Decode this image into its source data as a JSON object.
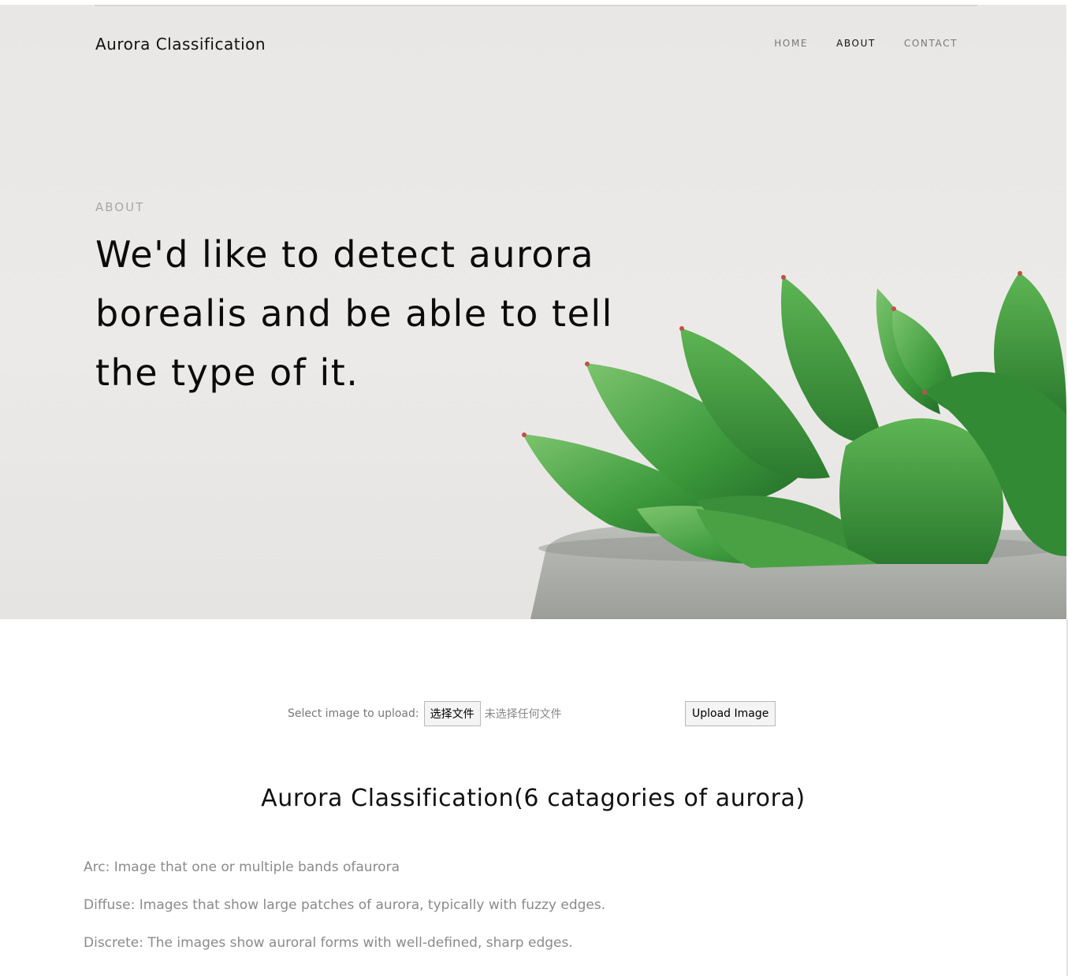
{
  "header": {
    "brand": "Aurora Classification",
    "nav": [
      {
        "label": "HOME",
        "active": false
      },
      {
        "label": "ABOUT",
        "active": true
      },
      {
        "label": "CONTACT",
        "active": false
      }
    ]
  },
  "hero": {
    "eyebrow": "ABOUT",
    "headline": "We'd like to detect aurora borealis and be able to tell the type of it."
  },
  "upload": {
    "label": "Select image to upload:",
    "choose_button": "选择文件",
    "file_status": "未选择任何文件",
    "submit_button": "Upload Image"
  },
  "classification": {
    "title": "Aurora Classification(6 catagories of aurora)",
    "items": [
      "Arc: Image that one or multiple bands ofaurora",
      "Diffuse: Images that show large patches of aurora, typically with fuzzy edges.",
      "Discrete: The images show auroral forms with well-defined, sharp edges."
    ]
  },
  "colors": {
    "hero_background": "#e9e7e5",
    "succulent_green": "#3f9a3f",
    "pot_gray": "#a8aaa6"
  }
}
